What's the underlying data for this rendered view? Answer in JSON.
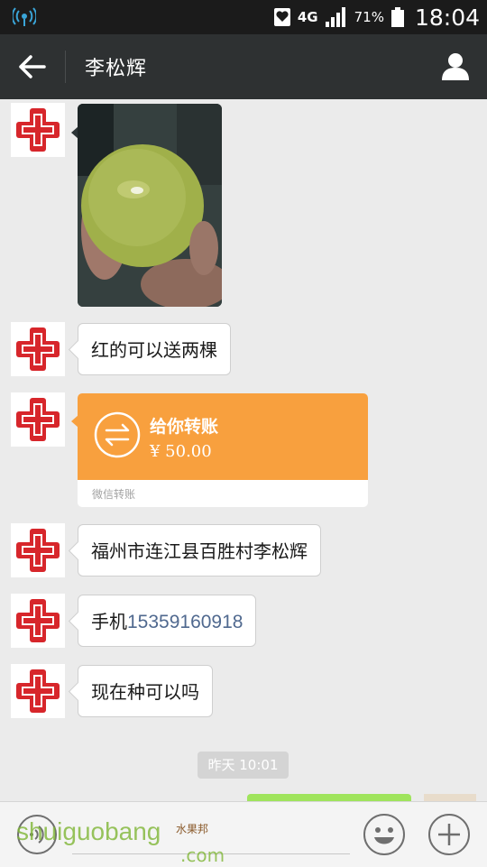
{
  "status_bar": {
    "network": "4G",
    "battery_percent": "71%",
    "time": "18:04"
  },
  "header": {
    "title": "李松辉",
    "back_icon": "back-arrow-icon",
    "profile_icon": "person-icon"
  },
  "messages": [
    {
      "type": "image",
      "sender": "contact",
      "description_icon": "photo-fruit"
    },
    {
      "type": "text",
      "sender": "contact",
      "text": "红的可以送两棵"
    },
    {
      "type": "transfer",
      "sender": "contact",
      "title": "给你转账",
      "amount": "¥ 50.00",
      "source": "微信转账"
    },
    {
      "type": "text",
      "sender": "contact",
      "text": "福州市连江县百胜村李松辉"
    },
    {
      "type": "text",
      "sender": "contact",
      "text_prefix": "手机",
      "phone": "15359160918"
    },
    {
      "type": "text",
      "sender": "contact",
      "text": "现在种可以吗"
    }
  ],
  "timestamp": "昨天 10:01",
  "input_bar": {
    "voice_icon": "voice-icon",
    "emoji_icon": "emoji-icon",
    "plus_icon": "plus-icon"
  },
  "watermark": {
    "main": "shuiguobang",
    "cn": "水果邦",
    "suffix": ".com"
  },
  "colors": {
    "header_bg": "#2e3132",
    "transfer_orange": "#f8a03e",
    "avatar_red": "#d7262b",
    "phone_link": "#50698f"
  }
}
